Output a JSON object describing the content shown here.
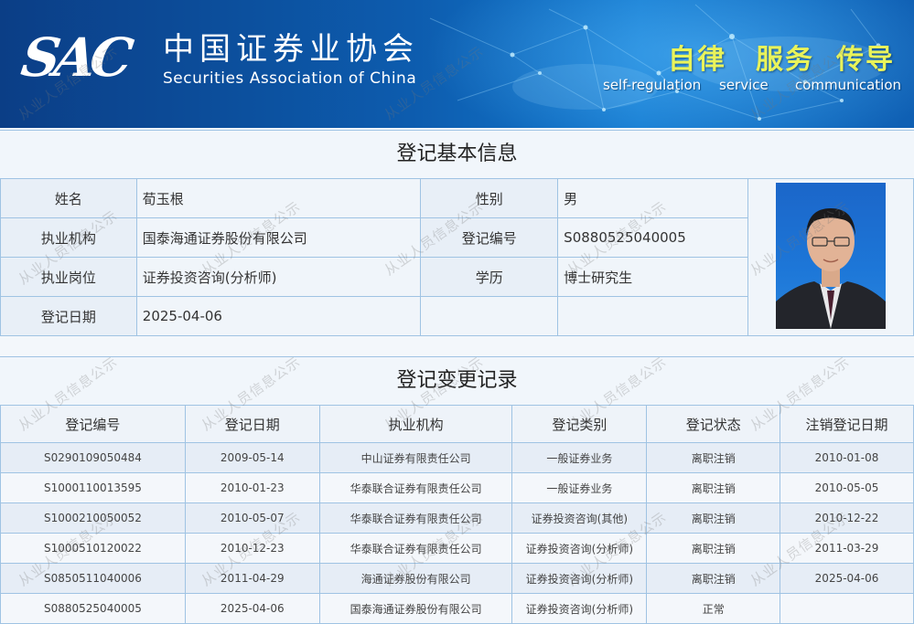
{
  "header": {
    "logo_abbr": "SAC",
    "org_name_cn": "中国证券业协会",
    "org_name_en": "Securities Association of China",
    "slogans": [
      {
        "cn": "自律",
        "en": "self-regulation"
      },
      {
        "cn": "服务",
        "en": "service"
      },
      {
        "cn": "传导",
        "en": "communication"
      }
    ]
  },
  "basic_info": {
    "title": "登记基本信息",
    "name_label": "姓名",
    "name": "荀玉根",
    "gender_label": "性别",
    "gender": "男",
    "institution_label": "执业机构",
    "institution": "国泰海通证券股份有限公司",
    "reg_no_label": "登记编号",
    "reg_no": "S0880525040005",
    "position_label": "执业岗位",
    "position": "证券投资咨询(分析师)",
    "education_label": "学历",
    "education": "博士研究生",
    "reg_date_label": "登记日期",
    "reg_date": "2025-04-06"
  },
  "history": {
    "title": "登记变更记录",
    "columns": [
      "登记编号",
      "登记日期",
      "执业机构",
      "登记类别",
      "登记状态",
      "注销登记日期"
    ],
    "rows": [
      [
        "S0290109050484",
        "2009-05-14",
        "中山证券有限责任公司",
        "一般证券业务",
        "离职注销",
        "2010-01-08"
      ],
      [
        "S1000110013595",
        "2010-01-23",
        "华泰联合证券有限责任公司",
        "一般证券业务",
        "离职注销",
        "2010-05-05"
      ],
      [
        "S1000210050052",
        "2010-05-07",
        "华泰联合证券有限责任公司",
        "证券投资咨询(其他)",
        "离职注销",
        "2010-12-22"
      ],
      [
        "S1000510120022",
        "2010-12-23",
        "华泰联合证券有限责任公司",
        "证券投资咨询(分析师)",
        "离职注销",
        "2011-03-29"
      ],
      [
        "S0850511040006",
        "2011-04-29",
        "海通证券股份有限公司",
        "证券投资咨询(分析师)",
        "离职注销",
        "2025-04-06"
      ],
      [
        "S0880525040005",
        "2025-04-06",
        "国泰海通证券股份有限公司",
        "证券投资咨询(分析师)",
        "正常",
        ""
      ]
    ]
  },
  "watermark_text": "从业人员信息公示",
  "colors": {
    "banner_dark": "#0b3e86",
    "banner_light": "#1379cf",
    "slogan_yellow": "#e9f35a",
    "border_blue": "#9fc3e3"
  }
}
